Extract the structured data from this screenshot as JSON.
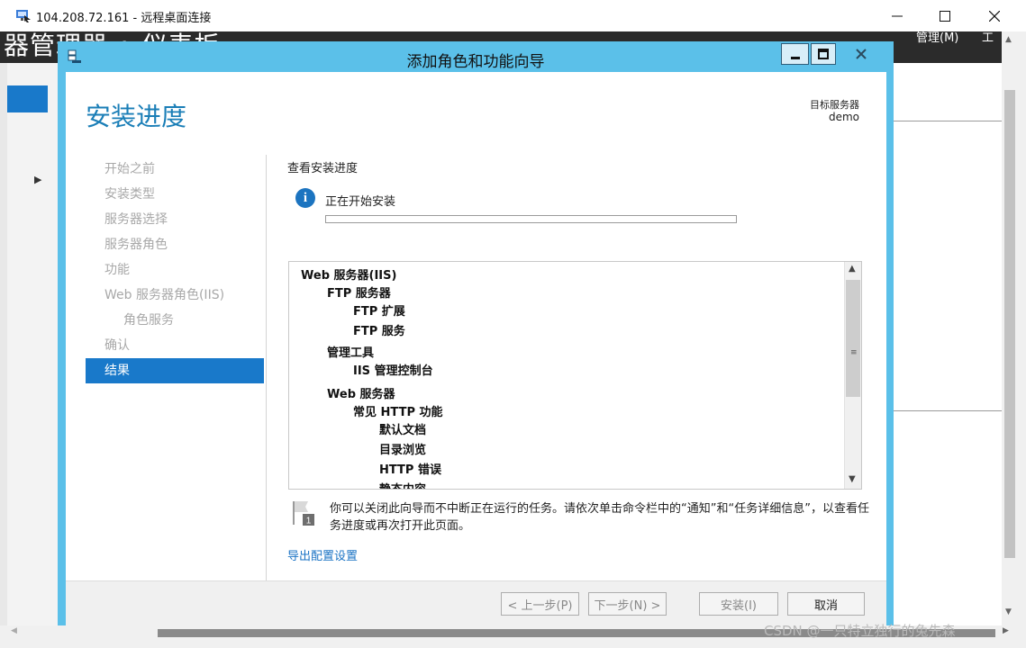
{
  "rdp": {
    "title": "104.208.72.161 - 远程桌面连接",
    "min_icon": "minimize-icon",
    "max_icon": "maximize-icon",
    "close_icon": "close-icon"
  },
  "server_manager": {
    "breadcrumb": "器管理器 • 仪表板",
    "menu_manage": "管理(M)",
    "menu_tools": "工"
  },
  "wizard": {
    "title": "添加角色和功能向导",
    "page_title": "安装进度",
    "target_label": "目标服务器",
    "target_value": "demo",
    "steps": [
      {
        "label": "开始之前",
        "state": "disabled"
      },
      {
        "label": "安装类型",
        "state": "disabled"
      },
      {
        "label": "服务器选择",
        "state": "disabled"
      },
      {
        "label": "服务器角色",
        "state": "disabled"
      },
      {
        "label": "功能",
        "state": "disabled"
      },
      {
        "label": "Web 服务器角色(IIS)",
        "state": "disabled"
      },
      {
        "label": "角色服务",
        "state": "disabled",
        "sub": true
      },
      {
        "label": "确认",
        "state": "disabled"
      },
      {
        "label": "结果",
        "state": "active"
      }
    ],
    "section_label": "查看安装进度",
    "status_text": "正在开始安装",
    "progress": 0,
    "tree": [
      {
        "label": "Web 服务器(IIS)",
        "level": 0
      },
      {
        "label": "FTP 服务器",
        "level": 1
      },
      {
        "label": "FTP 扩展",
        "level": 2
      },
      {
        "label": "FTP 服务",
        "level": 2
      },
      {
        "label": "管理工具",
        "level": 1
      },
      {
        "label": "IIS 管理控制台",
        "level": 2
      },
      {
        "label": "Web 服务器",
        "level": 1
      },
      {
        "label": "常见 HTTP 功能",
        "level": 2
      },
      {
        "label": "默认文档",
        "level": 3
      },
      {
        "label": "目录浏览",
        "level": 3
      },
      {
        "label": "HTTP 错误",
        "level": 3
      },
      {
        "label": "静态内容",
        "level": 3
      }
    ],
    "note": "你可以关闭此向导而不中断正在运行的任务。请依次单击命令栏中的“通知”和“任务详细信息”，以查看任务进度或再次打开此页面。",
    "export_link": "导出配置设置",
    "buttons": {
      "prev": "< 上一步(P)",
      "next": "下一步(N) >",
      "install": "安装(I)",
      "cancel": "取消"
    },
    "colors": {
      "accent": "#1979ca",
      "title_bar": "#5bc0e9",
      "page_title": "#1a7eb7"
    }
  },
  "watermark": "CSDN @一只特立独行的兔先森"
}
